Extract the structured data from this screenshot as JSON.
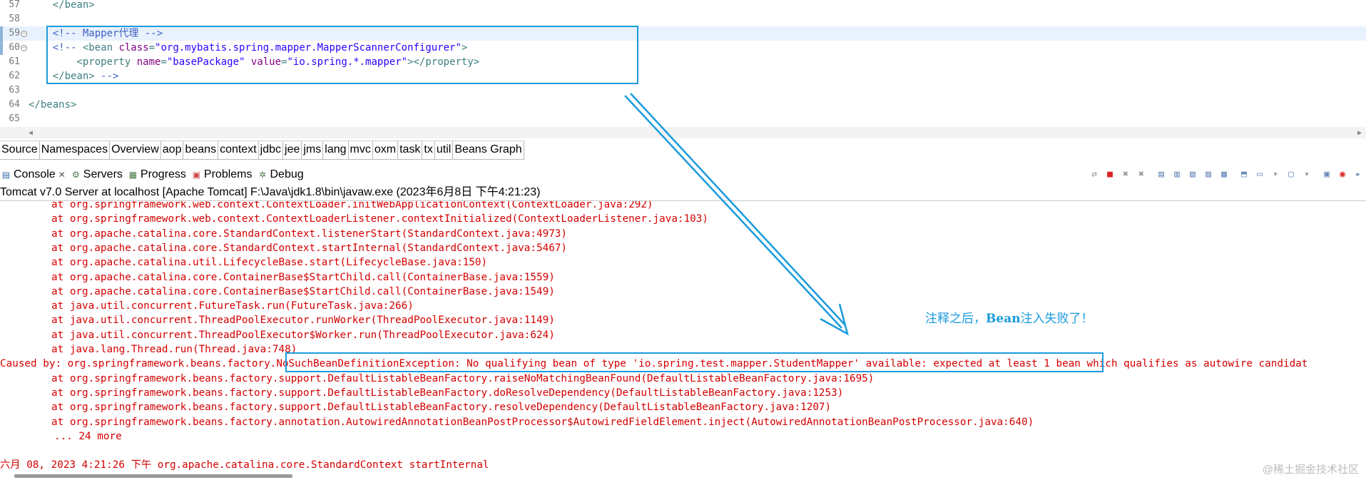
{
  "editor": {
    "lines": [
      {
        "num": "57",
        "fold": false,
        "current": false,
        "parts": [
          [
            "c-tag",
            "    </bean>"
          ]
        ]
      },
      {
        "num": "58",
        "fold": false,
        "current": false,
        "parts": []
      },
      {
        "num": "59",
        "fold": true,
        "current": true,
        "parts": [
          [
            "c-comment",
            "    <!-- Mapper代理 -->"
          ]
        ]
      },
      {
        "num": "60",
        "fold": true,
        "current": false,
        "parts": [
          [
            "c-comment",
            "    <!-- "
          ],
          [
            "c-tag",
            "<bean "
          ],
          [
            "c-attr",
            "class"
          ],
          [
            "c-tag",
            "="
          ],
          [
            "c-val",
            "\"org.mybatis.spring.mapper.MapperScannerConfigurer\""
          ],
          [
            "c-tag",
            ">"
          ]
        ]
      },
      {
        "num": "61",
        "fold": false,
        "current": false,
        "parts": [
          [
            "c-tag",
            "        <property "
          ],
          [
            "c-attr",
            "name"
          ],
          [
            "c-tag",
            "="
          ],
          [
            "c-val",
            "\"basePackage\" "
          ],
          [
            "c-attr",
            "value"
          ],
          [
            "c-tag",
            "="
          ],
          [
            "c-val",
            "\"io.spring.*.mapper\""
          ],
          [
            "c-tag",
            "></property>"
          ]
        ]
      },
      {
        "num": "62",
        "fold": false,
        "current": false,
        "parts": [
          [
            "c-tag",
            "    </bean> "
          ],
          [
            "c-comment",
            "-->"
          ]
        ]
      },
      {
        "num": "63",
        "fold": false,
        "current": false,
        "parts": []
      },
      {
        "num": "64",
        "fold": false,
        "current": false,
        "parts": [
          [
            "c-tag",
            "</beans>"
          ]
        ]
      },
      {
        "num": "65",
        "fold": false,
        "current": false,
        "parts": []
      }
    ],
    "tabs": [
      "Source",
      "Namespaces",
      "Overview",
      "aop",
      "beans",
      "context",
      "jdbc",
      "jee",
      "jms",
      "lang",
      "mvc",
      "oxm",
      "task",
      "tx",
      "util",
      "Beans Graph"
    ]
  },
  "views": {
    "tabs": [
      {
        "label": "Console",
        "icon": "console-icon",
        "glyph": "▤"
      },
      {
        "label": "Servers",
        "icon": "servers-icon",
        "glyph": "⚙"
      },
      {
        "label": "Progress",
        "icon": "progress-icon",
        "glyph": "▦"
      },
      {
        "label": "Problems",
        "icon": "problems-icon",
        "glyph": "▣"
      },
      {
        "label": "Debug",
        "icon": "debug-icon",
        "glyph": "✲"
      }
    ],
    "close_glyph": "✕"
  },
  "toolbar": [
    {
      "name": "pin-icon",
      "glyph": "⇄",
      "cls": "gray"
    },
    {
      "name": "terminate-icon",
      "glyph": "■",
      "cls": "red"
    },
    {
      "name": "remove-launch-icon",
      "glyph": "✖",
      "cls": "gray"
    },
    {
      "name": "remove-all-icon",
      "glyph": "✖",
      "cls": "gray"
    },
    {
      "name": "sep",
      "glyph": "",
      "cls": "sep"
    },
    {
      "name": "copy-icon",
      "glyph": "▤",
      "cls": ""
    },
    {
      "name": "scroll-lock-icon",
      "glyph": "▥",
      "cls": ""
    },
    {
      "name": "word-wrap-icon",
      "glyph": "▧",
      "cls": ""
    },
    {
      "name": "show-stdout-icon",
      "glyph": "▨",
      "cls": ""
    },
    {
      "name": "show-stderr-icon",
      "glyph": "▩",
      "cls": ""
    },
    {
      "name": "sep",
      "glyph": "",
      "cls": "sep"
    },
    {
      "name": "pin-console-icon",
      "glyph": "⬒",
      "cls": ""
    },
    {
      "name": "display-console-icon",
      "glyph": "▭",
      "cls": ""
    },
    {
      "name": "chevron-down-icon",
      "glyph": "▾",
      "cls": "gray"
    },
    {
      "name": "new-console-icon",
      "glyph": "▢",
      "cls": ""
    },
    {
      "name": "chevron-down-icon",
      "glyph": "▾",
      "cls": "gray"
    },
    {
      "name": "sep",
      "glyph": "",
      "cls": "sep"
    },
    {
      "name": "minimize-icon",
      "glyph": "▣",
      "cls": ""
    },
    {
      "name": "maximize-icon",
      "glyph": "◉",
      "cls": "red"
    },
    {
      "name": "more-icon",
      "glyph": "▸",
      "cls": ""
    }
  ],
  "console": {
    "title": "Tomcat v7.0 Server at localhost [Apache Tomcat] F:\\Java\\jdk1.8\\bin\\javaw.exe (2023年6月8日 下午4:21:23)",
    "lines": [
      {
        "kind": "ind",
        "text": "at org.springframework.web.context.ContextLoader.initWebApplicationContext(ContextLoader.java:292)"
      },
      {
        "kind": "ind",
        "text": "at org.springframework.web.context.ContextLoaderListener.contextInitialized(ContextLoaderListener.java:103)"
      },
      {
        "kind": "ind",
        "text": "at org.apache.catalina.core.StandardContext.listenerStart(StandardContext.java:4973)"
      },
      {
        "kind": "ind",
        "text": "at org.apache.catalina.core.StandardContext.startInternal(StandardContext.java:5467)"
      },
      {
        "kind": "ind",
        "text": "at org.apache.catalina.util.LifecycleBase.start(LifecycleBase.java:150)"
      },
      {
        "kind": "ind",
        "text": "at org.apache.catalina.core.ContainerBase$StartChild.call(ContainerBase.java:1559)"
      },
      {
        "kind": "ind",
        "text": "at org.apache.catalina.core.ContainerBase$StartChild.call(ContainerBase.java:1549)"
      },
      {
        "kind": "ind",
        "text": "at java.util.concurrent.FutureTask.run(FutureTask.java:266)"
      },
      {
        "kind": "ind",
        "text": "at java.util.concurrent.ThreadPoolExecutor.runWorker(ThreadPoolExecutor.java:1149)"
      },
      {
        "kind": "ind",
        "text": "at java.util.concurrent.ThreadPoolExecutor$Worker.run(ThreadPoolExecutor.java:624)"
      },
      {
        "kind": "ind",
        "text": "at java.lang.Thread.run(Thread.java:748)"
      },
      {
        "kind": "cause",
        "text": "Caused by: org.springframework.beans.factory.NoSuchBeanDefinitionException: No qualifying bean of type 'io.spring.test.mapper.StudentMapper' available: expected at least 1 bean which qualifies as autowire candidat"
      },
      {
        "kind": "ind",
        "text": "at org.springframework.beans.factory.support.DefaultListableBeanFactory.raiseNoMatchingBeanFound(DefaultListableBeanFactory.java:1695)"
      },
      {
        "kind": "ind",
        "text": "at org.springframework.beans.factory.support.DefaultListableBeanFactory.doResolveDependency(DefaultListableBeanFactory.java:1253)"
      },
      {
        "kind": "ind",
        "text": "at org.springframework.beans.factory.support.DefaultListableBeanFactory.resolveDependency(DefaultListableBeanFactory.java:1207)"
      },
      {
        "kind": "ind",
        "text": "at org.springframework.beans.factory.annotation.AutowiredAnnotationBeanPostProcessor$AutowiredFieldElement.inject(AutowiredAnnotationBeanPostProcessor.java:640)"
      },
      {
        "kind": "more",
        "text": "... 24 more"
      },
      {
        "kind": "blank",
        "text": ""
      },
      {
        "kind": "cause",
        "text": "六月 08, 2023 4:21:26 下午 org.apache.catalina.core.StandardContext startInternal"
      }
    ]
  },
  "annotation": {
    "prefix": "注释之后，",
    "bold": "Bean",
    "suffix": "注入失败了！"
  },
  "watermark": "@稀土掘金技术社区",
  "colors": {
    "accent": "#1a9bdd",
    "error": "#d40000"
  }
}
